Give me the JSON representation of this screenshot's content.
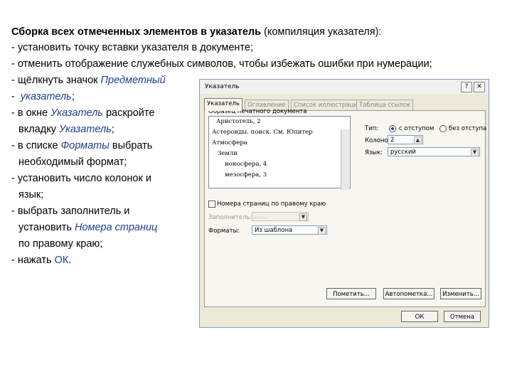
{
  "instructions": {
    "heading_bold": "Сборка всех отмеченных элементов в указатель",
    "heading_rest": " (компиляция указателя):",
    "line_insertion_point": "- установить точку вставки указателя в документе;",
    "line_hide_symbols": "- отменить отображение служебных символов, чтобы избежать ошибки при нумерации;",
    "step_icon_prefix": "- щёлкнуть значок ",
    "step_icon_word": "Предметный",
    "step_icon_dash": "- ",
    "step_icon_word2": "указатель",
    "step_icon_end": ";",
    "step_window_prefix": "- в окне ",
    "step_window_word": "Указатель",
    "step_window_rest": " раскройте",
    "step_tab_indent": "вкладку ",
    "step_tab_word": "Указатель",
    "step_tab_end": ";",
    "step_formats_prefix": "- в списке ",
    "step_formats_word": "Форматы",
    "step_formats_rest": "  выбрать",
    "step_formats_line2": "необходимый формат;",
    "step_columns_line1": "- установить число колонок и",
    "step_columns_line2": "язык;",
    "step_filler_line1": "- выбрать заполнитель и",
    "step_filler_line2_prefix": "установить ",
    "step_filler_word": "Номера страниц",
    "step_filler_line3": "по правому краю;",
    "step_ok_prefix": "- нажать ",
    "step_ok_word": "ОК",
    "step_ok_end": "."
  },
  "dialog": {
    "title": "Указатель",
    "help_glyph": "?",
    "close_glyph": "✕",
    "tabs": [
      "Указатель",
      "Оглавление",
      "Список иллюстраций",
      "Таблица ссылок"
    ],
    "preview_label": "Образец печатного документа",
    "preview_lines": [
      "Аристотель, 2",
      "Астероиды. поиск. См. Юпитер",
      "Атмосфера",
      "Земли",
      "ионосфера, 4",
      "мезосфера, 3"
    ],
    "type_label": "Тип:",
    "radio_indent": "с отступом",
    "radio_runin": "без отступа",
    "columns_label": "Колонок:",
    "columns_value": "2",
    "language_label": "Язык:",
    "language_value": "русский",
    "right_align_label": "Номера страниц по правому краю",
    "filler_label": "Заполнитель:",
    "filler_value": ".......",
    "formats_label": "Форматы:",
    "formats_value": "Из шаблона",
    "btn_mark": "Пометить...",
    "btn_automark": "Автопометка...",
    "btn_modify": "Изменить...",
    "btn_ok": "ОК",
    "btn_cancel": "Отмена"
  }
}
